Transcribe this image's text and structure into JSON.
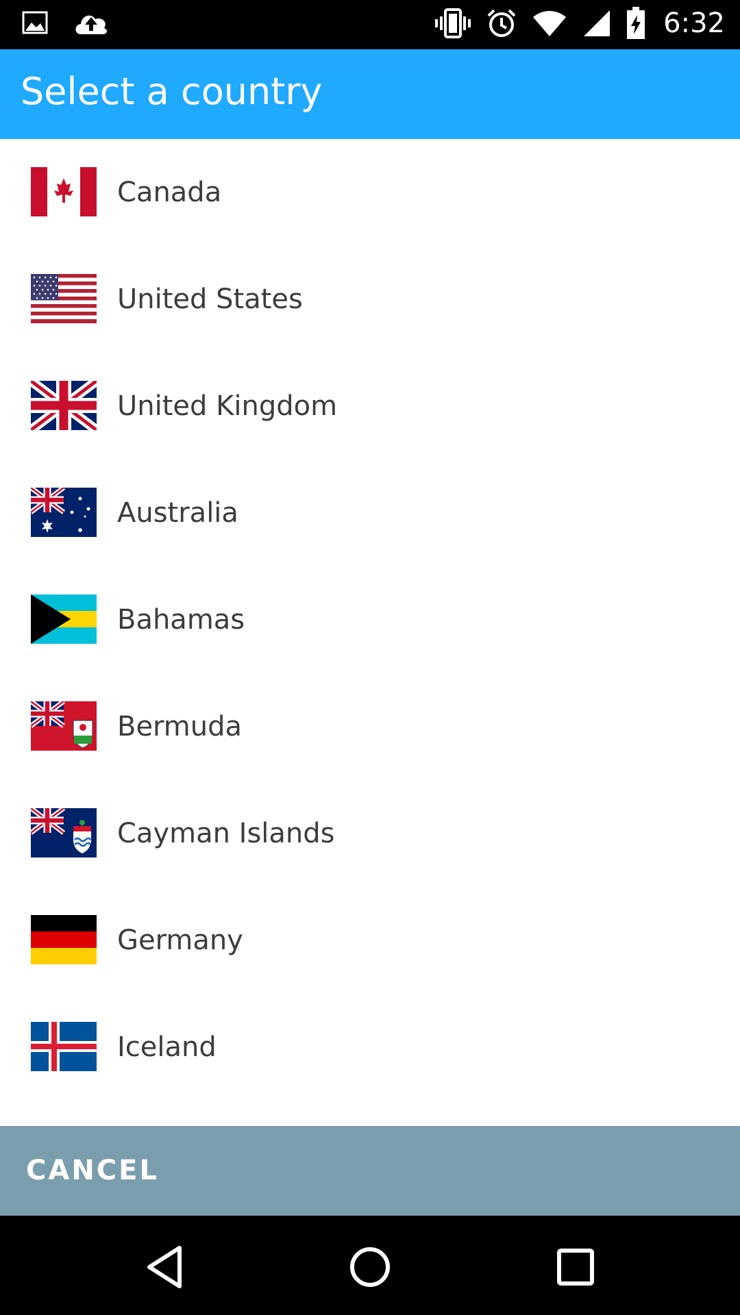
{
  "status_bar": {
    "time": "6:32",
    "icons": [
      "image-icon",
      "cloud-upload-icon",
      "vibrate-icon",
      "alarm-icon",
      "wifi-icon",
      "signal-icon",
      "battery-charging-icon"
    ]
  },
  "app_bar": {
    "title": "Select a country"
  },
  "countries": [
    {
      "name": "Canada",
      "flag": "canada-flag-icon"
    },
    {
      "name": "United States",
      "flag": "united-states-flag-icon"
    },
    {
      "name": "United Kingdom",
      "flag": "united-kingdom-flag-icon"
    },
    {
      "name": "Australia",
      "flag": "australia-flag-icon"
    },
    {
      "name": "Bahamas",
      "flag": "bahamas-flag-icon"
    },
    {
      "name": "Bermuda",
      "flag": "bermuda-flag-icon"
    },
    {
      "name": "Cayman Islands",
      "flag": "cayman-islands-flag-icon"
    },
    {
      "name": "Germany",
      "flag": "germany-flag-icon"
    },
    {
      "name": "Iceland",
      "flag": "iceland-flag-icon"
    }
  ],
  "actions": {
    "cancel_label": "CANCEL"
  },
  "nav_bar": {
    "buttons": [
      "back-icon",
      "home-icon",
      "recents-icon"
    ]
  },
  "colors": {
    "app_bar": "#1fa9ff",
    "cancel_bar": "#7a9eae",
    "text": "#3c3c3c"
  }
}
